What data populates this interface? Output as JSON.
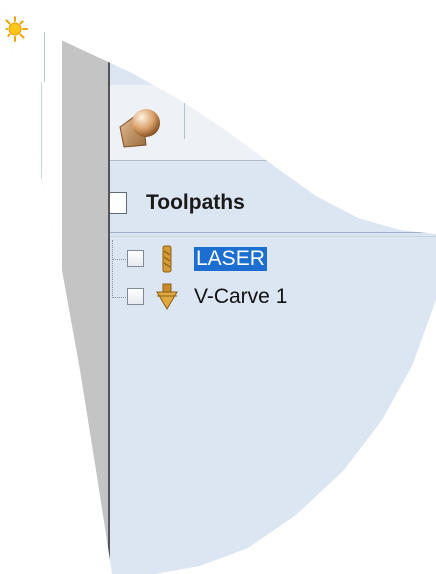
{
  "panel": {
    "title": "Toolpaths"
  },
  "toolbar": {
    "icons": [
      "sun-icon",
      "3d-view-icon"
    ]
  },
  "toolpaths": [
    {
      "name": "LASER",
      "checked": false,
      "selected": true,
      "icon": "laser-tool-icon"
    },
    {
      "name": "V-Carve 1",
      "checked": false,
      "selected": false,
      "icon": "v-bit-icon"
    }
  ],
  "colors": {
    "panel_bg": "#dce6f2",
    "selection": "#1c6fd1",
    "tool_gold": "#c8952e"
  }
}
